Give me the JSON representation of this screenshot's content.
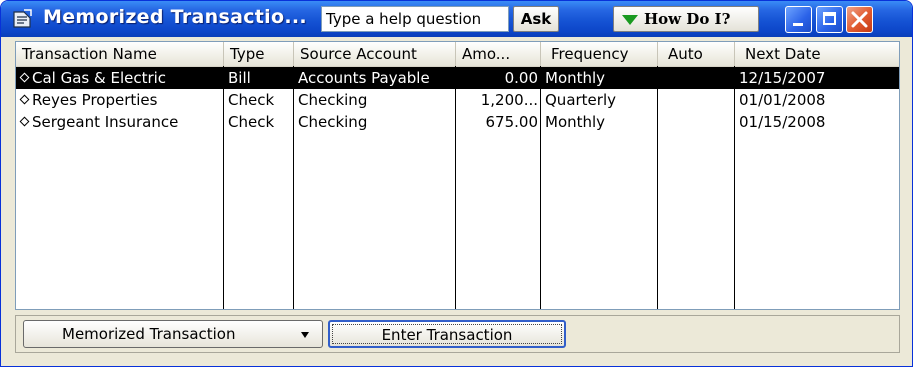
{
  "window": {
    "title": "Memorized Transactio...",
    "help_placeholder": "Type a help question",
    "ask_label": "Ask",
    "howdoi_label": "How Do I?",
    "colors": {
      "titlebar": "#1553d4",
      "selection": "#000000",
      "close": "#e15a2e"
    },
    "icons": [
      "app-icon",
      "minimize-icon",
      "maximize-icon",
      "close-icon"
    ]
  },
  "list": {
    "columns": [
      "Transaction Name",
      "Type",
      "Source Account",
      "Amo...",
      "Frequency",
      "Auto",
      "Next Date"
    ],
    "rows": [
      {
        "name": "Cal Gas & Electric",
        "type": "Bill",
        "source": "Accounts Payable",
        "amount": "0.00",
        "frequency": "Monthly",
        "auto": "",
        "next_date": "12/15/2007",
        "selected": true
      },
      {
        "name": "Reyes Properties",
        "type": "Check",
        "source": "Checking",
        "amount": "1,200...",
        "frequency": "Quarterly",
        "auto": "",
        "next_date": "01/01/2008",
        "selected": false
      },
      {
        "name": "Sergeant Insurance",
        "type": "Check",
        "source": "Checking",
        "amount": "675.00",
        "frequency": "Monthly",
        "auto": "",
        "next_date": "01/15/2008",
        "selected": false
      }
    ]
  },
  "buttons": {
    "memorized_transaction": "Memorized Transaction",
    "enter_transaction": "Enter Transaction"
  }
}
